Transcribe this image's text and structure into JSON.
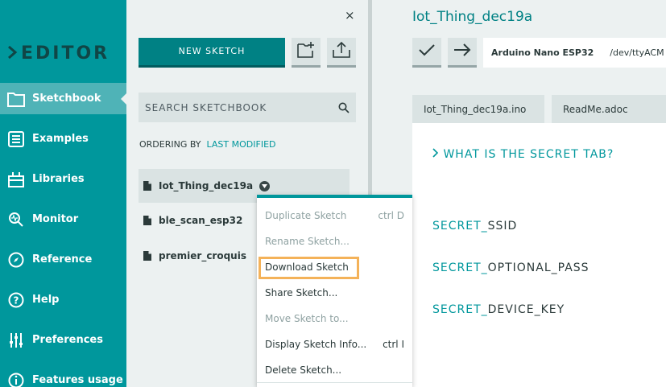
{
  "sidebar": {
    "logo": "EDITOR",
    "items": [
      {
        "label": "Sketchbook",
        "icon": "folder-icon",
        "active": true
      },
      {
        "label": "Examples",
        "icon": "list-icon"
      },
      {
        "label": "Libraries",
        "icon": "books-icon"
      },
      {
        "label": "Monitor",
        "icon": "monitor-icon"
      },
      {
        "label": "Reference",
        "icon": "compass-icon"
      },
      {
        "label": "Help",
        "icon": "help-icon"
      },
      {
        "label": "Preferences",
        "icon": "sliders-icon"
      },
      {
        "label": "Features usage",
        "icon": "info-icon"
      }
    ]
  },
  "panel": {
    "close": "×",
    "new_sketch": "NEW SKETCH",
    "search_placeholder": "SEARCH SKETCHBOOK",
    "ordering_label": "ORDERING BY",
    "ordering_value": "LAST MODIFIED",
    "sketches": [
      {
        "name": "Iot_Thing_dec19a",
        "selected": true
      },
      {
        "name": "ble_scan_esp32"
      },
      {
        "name": "premier_croquis"
      }
    ]
  },
  "context_menu": {
    "items": [
      {
        "label": "Duplicate Sketch",
        "shortcut": "ctrl D",
        "disabled": true
      },
      {
        "label": "Rename Sketch...",
        "shortcut": "",
        "disabled": true
      },
      {
        "label": "Download Sketch",
        "shortcut": "",
        "highlight": true
      },
      {
        "label": "Share Sketch...",
        "shortcut": ""
      },
      {
        "label": "Move Sketch to...",
        "shortcut": "",
        "disabled": true
      },
      {
        "label": "Display Sketch Info...",
        "shortcut": "ctrl I"
      },
      {
        "label": "Delete Sketch...",
        "shortcut": ""
      }
    ]
  },
  "editor": {
    "sketch_title": "Iot_Thing_dec19a",
    "board_name": "Arduino Nano ESP32",
    "port": "/dev/ttyACM",
    "tabs": [
      "Iot_Thing_dec19a.ino",
      "ReadMe.adoc"
    ],
    "secret_tab_heading": "WHAT IS THE SECRET TAB?",
    "secret_prefix": "SECRET_",
    "secrets": [
      "SSID",
      "OPTIONAL_PASS",
      "DEVICE_KEY"
    ]
  },
  "colors": {
    "sidebar_bg": "#00979c",
    "accent": "#008184",
    "highlight": "#f4b259"
  }
}
